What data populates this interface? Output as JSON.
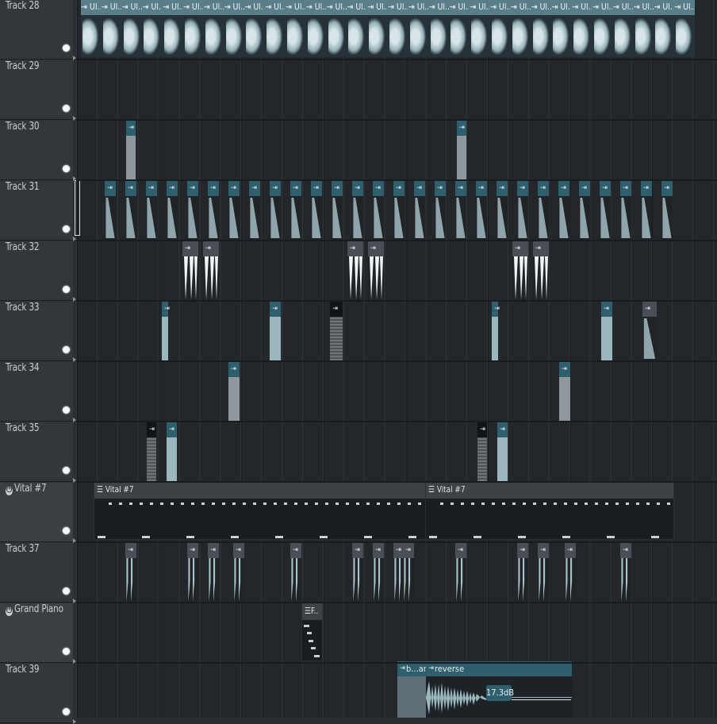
{
  "tracks": [
    {
      "label": "Track 28",
      "plugin": false
    },
    {
      "label": "Track 29",
      "plugin": false
    },
    {
      "label": "Track 30",
      "plugin": false
    },
    {
      "label": "Track 31",
      "plugin": false
    },
    {
      "label": "Track 32",
      "plugin": false
    },
    {
      "label": "Track 33",
      "plugin": false
    },
    {
      "label": "Track 34",
      "plugin": false
    },
    {
      "label": "Track 35",
      "plugin": false
    },
    {
      "label": "Vital #7",
      "plugin": true
    },
    {
      "label": "Track 37",
      "plugin": false
    },
    {
      "label": "Grand Piano",
      "plugin": true
    },
    {
      "label": "Track 39",
      "plugin": false
    }
  ],
  "track28_clip_label": "Ul..",
  "vital_pattern_label": "Vital #7",
  "piano_pattern_label": "F..",
  "track39": {
    "clip_a_label": "b...am",
    "clip_b_label": "reverse",
    "gain_badge": "17.3dB"
  },
  "icons": {
    "clip_arrow": "play-marker-icon",
    "pattern": "pattern-icon",
    "plugin": "plugin-icon",
    "mute": "mute-led-icon"
  },
  "colors": {
    "clip_header": "#2f5e6c",
    "waveform": "#9ab7be",
    "grid_bg": "#23272b"
  }
}
